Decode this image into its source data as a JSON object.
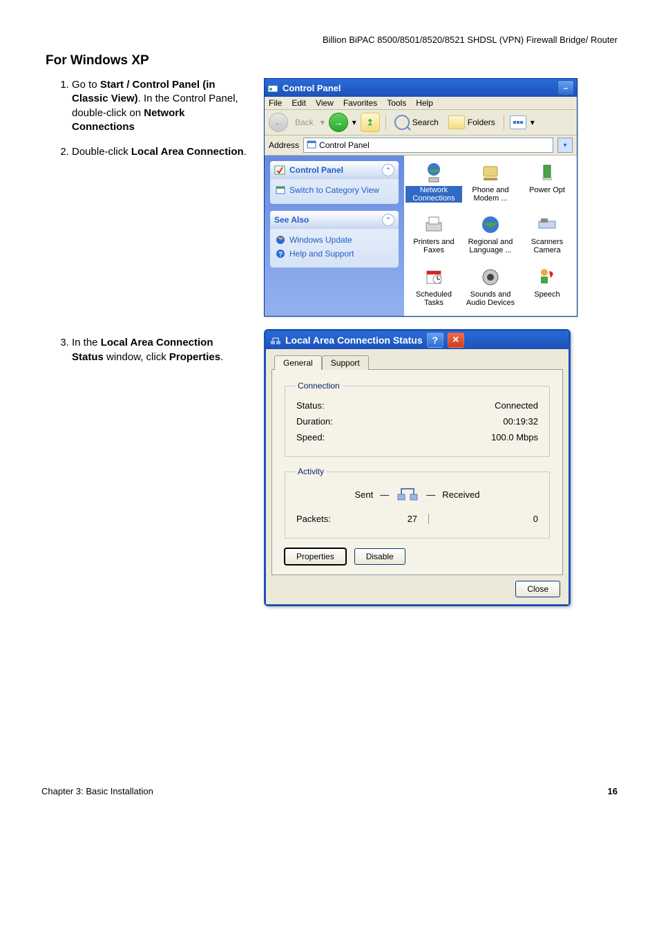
{
  "header": "Billion BiPAC 8500/8501/8520/8521 SHDSL (VPN) Firewall Bridge/ Router",
  "section_title": "For Windows XP",
  "steps": {
    "s1": {
      "a": "Go to ",
      "b1": "Start / Control Panel (in Classic View)",
      "c": ". In the Control Panel, double-click on ",
      "b2": "Network Connections"
    },
    "s2": {
      "a": "Double-click ",
      "b1": "Local Area Connection",
      "c": "."
    },
    "s3": {
      "a": "In the ",
      "b1": "Local Area Connection Status",
      "c": " window, click ",
      "b2": "Properties",
      "d": "."
    }
  },
  "cp": {
    "title": "Control Panel",
    "menu": {
      "file": "File",
      "edit": "Edit",
      "view": "View",
      "fav": "Favorites",
      "tools": "Tools",
      "help": "Help"
    },
    "toolbar": {
      "back": "Back",
      "search": "Search",
      "folders": "Folders"
    },
    "address": {
      "label": "Address",
      "value": "Control Panel"
    },
    "panel1": {
      "title": "Control Panel",
      "link1": "Switch to Category View"
    },
    "panel2": {
      "title": "See Also",
      "link1": "Windows Update",
      "link2": "Help and Support"
    },
    "items": {
      "i1": "Network Connections",
      "i2": "Phone and Modem ...",
      "i3": "Power Opt",
      "i4": "Printers and Faxes",
      "i5": "Regional and Language ...",
      "i6": "Scanners Camera",
      "i7": "Scheduled Tasks",
      "i8": "Sounds and Audio Devices",
      "i9": "Speech"
    }
  },
  "dlg": {
    "title": "Local Area Connection Status",
    "tabs": {
      "general": "General",
      "support": "Support"
    },
    "conn": {
      "legend": "Connection",
      "status_l": "Status:",
      "status_v": "Connected",
      "dur_l": "Duration:",
      "dur_v": "00:19:32",
      "spd_l": "Speed:",
      "spd_v": "100.0 Mbps"
    },
    "act": {
      "legend": "Activity",
      "sent": "Sent",
      "recv": "Received",
      "pkt_l": "Packets:",
      "pkt_sent": "27",
      "pkt_recv": "0"
    },
    "btn": {
      "prop": "Properties",
      "dis": "Disable",
      "close": "Close"
    }
  },
  "footer": {
    "left": "Chapter 3: Basic Installation",
    "right": "16"
  }
}
